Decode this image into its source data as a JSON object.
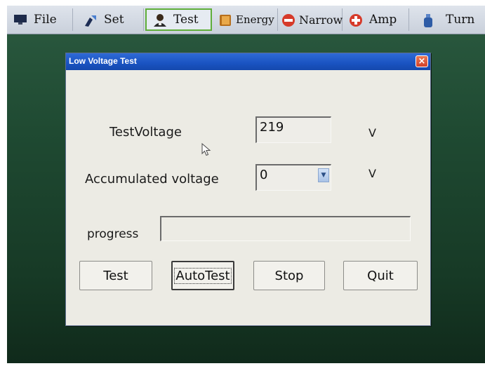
{
  "menubar": {
    "items": [
      {
        "label": "File",
        "icon": "monitor-icon"
      },
      {
        "label": "Set",
        "icon": "tools-icon"
      },
      {
        "label": "Test",
        "icon": "person-icon",
        "active": true
      },
      {
        "label": "Energy",
        "icon": "book-icon"
      },
      {
        "label": "Narrow",
        "icon": "minus-circle-icon"
      },
      {
        "label": "Amp",
        "icon": "plus-circle-icon"
      },
      {
        "label": "Turn",
        "icon": "bottle-icon"
      }
    ]
  },
  "dialog": {
    "title": "Low Voltage Test",
    "close_label": "×",
    "test_voltage": {
      "label": "TestVoltage",
      "value": "219",
      "unit": "V"
    },
    "accumulated_voltage": {
      "label": "Accumulated voltage",
      "value": "0",
      "unit": "V"
    },
    "progress": {
      "label": "progress",
      "value": 0
    },
    "buttons": {
      "test": "Test",
      "autotest": "AutoTest",
      "stop": "Stop",
      "quit": "Quit"
    }
  },
  "colors": {
    "titlebar": "#1a53c1",
    "desktop": "#1f4a32",
    "active_tab_border": "#5fae3a"
  }
}
